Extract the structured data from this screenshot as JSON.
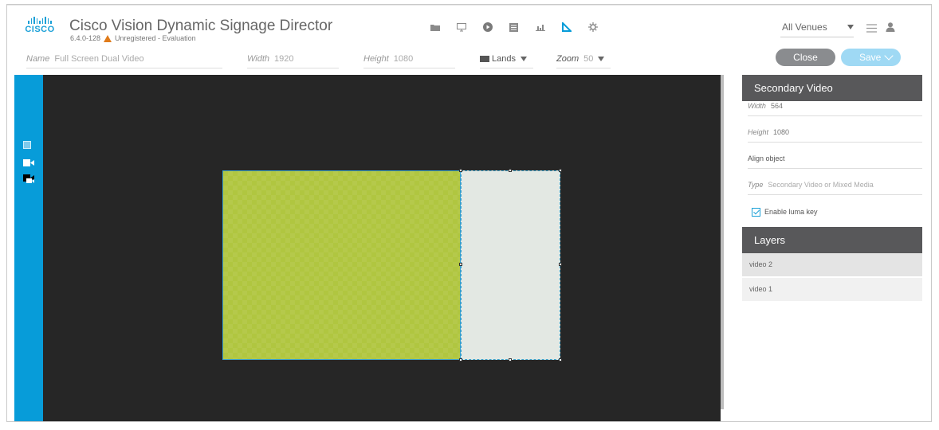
{
  "app": {
    "logo_text": "CISCO",
    "title": "Cisco Vision Dynamic Signage Director",
    "version": "6.4.0-128",
    "registration": "Unregistered - Evaluation",
    "accent_color": "#079cd9"
  },
  "toolbar": {
    "icons": [
      "folder-icon",
      "monitor-icon",
      "play-icon",
      "list-icon",
      "chart-icon",
      "design-icon",
      "gear-icon"
    ],
    "active_icon": "design-icon"
  },
  "venue": {
    "selected": "All Venues"
  },
  "properties": {
    "name_label": "Name",
    "name_value": "Full Screen Dual Video",
    "width_label": "Width",
    "width_value": "1920",
    "height_label": "Height",
    "height_value": "1080",
    "orientation_value": "Lands",
    "zoom_label": "Zoom",
    "zoom_value": "50"
  },
  "actions": {
    "close_label": "Close",
    "save_label": "Save"
  },
  "tools": [
    "rectangle-tool-icon",
    "video-tool-icon",
    "secondary-video-tool-icon"
  ],
  "panel": {
    "object_title": "Secondary Video",
    "width_label": "Width",
    "width_value": "564",
    "height_label": "Height",
    "height_value": "1080",
    "align_label": "Align object",
    "type_label": "Type",
    "type_value": "Secondary Video or Mixed Media",
    "luma_label": "Enable luma key",
    "luma_checked": true,
    "layers_title": "Layers",
    "layers": [
      "video 2",
      "video 1"
    ]
  }
}
